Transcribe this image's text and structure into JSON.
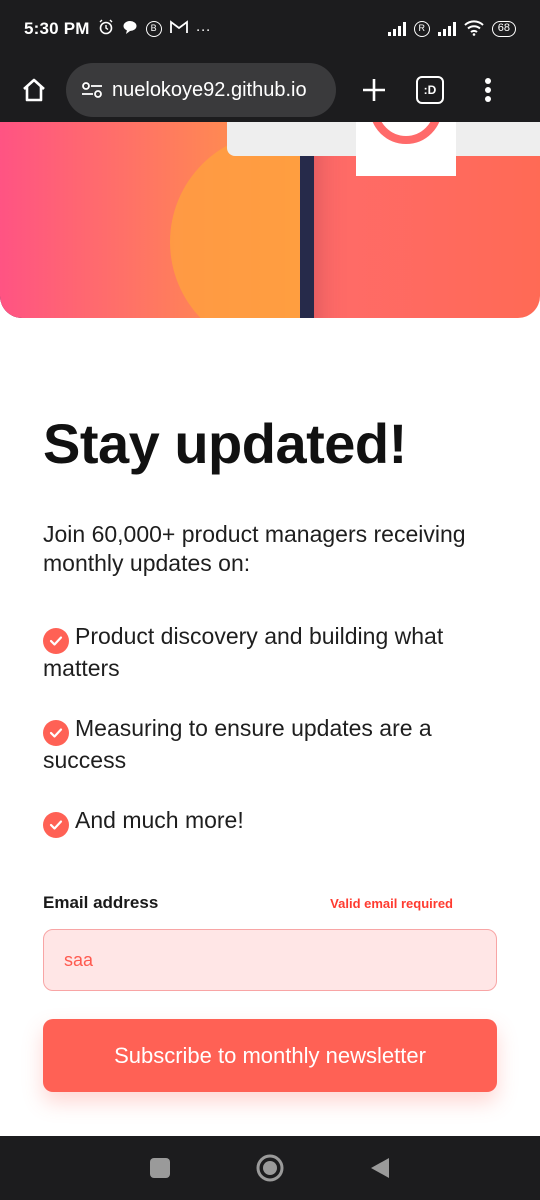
{
  "status_bar": {
    "time": "5:30 PM",
    "left_icons": [
      "alarm-icon",
      "chat-bubble-icon",
      "b-circle-icon",
      "gmail-icon"
    ],
    "more": "···",
    "b_badge": "B",
    "r_badge": "R",
    "battery": "68"
  },
  "browser": {
    "url": "nuelokoye92.github.io",
    "tabs_label": ":D"
  },
  "content": {
    "title": "Stay updated!",
    "intro": "Join 60,000+ product managers receiving monthly updates on:",
    "features": [
      {
        "text": "Product discovery and building what matters"
      },
      {
        "text": "Measuring to ensure updates are a success"
      },
      {
        "text": "And much more!"
      }
    ]
  },
  "form": {
    "label": "Email address",
    "error": "Valid email required",
    "email_value": "saa",
    "button_label": "Subscribe to monthly newsletter"
  },
  "colors": {
    "accent": "#ff6155",
    "error": "#ff3b30",
    "input_bg": "#ffe6e6",
    "title": "#111111"
  }
}
